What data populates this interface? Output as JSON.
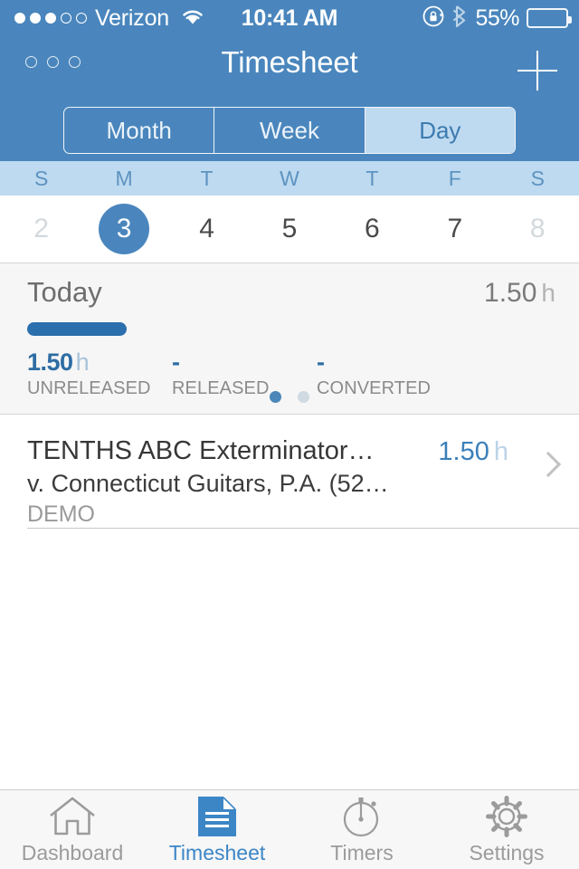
{
  "status_bar": {
    "signal_dots_filled": 3,
    "signal_dots_total": 5,
    "carrier": "Verizon",
    "wifi_icon": "wifi-icon",
    "time": "10:41 AM",
    "rotation_lock_icon": "rotation-lock-icon",
    "bluetooth_icon": "bluetooth-icon",
    "battery_percent": "55%",
    "battery_level": 55
  },
  "nav_bar": {
    "title": "Timesheet",
    "menu_icon": "three-dots-menu-icon",
    "add_icon": "plus-icon"
  },
  "segmented_control": {
    "options": [
      {
        "label": "Month",
        "selected": false
      },
      {
        "label": "Week",
        "selected": false
      },
      {
        "label": "Day",
        "selected": true
      }
    ]
  },
  "week_strip": {
    "day_names": [
      "S",
      "M",
      "T",
      "W",
      "T",
      "F",
      "S"
    ],
    "dates": [
      {
        "day": "2",
        "selected": false,
        "dimmed": true
      },
      {
        "day": "3",
        "selected": true,
        "dimmed": false
      },
      {
        "day": "4",
        "selected": false,
        "dimmed": false
      },
      {
        "day": "5",
        "selected": false,
        "dimmed": false
      },
      {
        "day": "6",
        "selected": false,
        "dimmed": false
      },
      {
        "day": "7",
        "selected": false,
        "dimmed": false
      },
      {
        "day": "8",
        "selected": false,
        "dimmed": true
      }
    ]
  },
  "summary": {
    "title": "Today",
    "total_value": "1.50",
    "total_unit": "h",
    "progress_percent": 24,
    "stats": [
      {
        "value": "1.50",
        "unit": "h",
        "label": "UNRELEASED"
      },
      {
        "value": "-",
        "unit": "",
        "label": "RELEASED"
      },
      {
        "value": "-",
        "unit": "",
        "label": "CONVERTED"
      }
    ],
    "page_dots": {
      "count": 2,
      "active_index": 0
    }
  },
  "entries": [
    {
      "title": "TENTHS ABC Exterminator…",
      "subtitle": "v. Connecticut Guitars, P.A. (52…",
      "tag": "DEMO",
      "hours": "1.50",
      "unit": "h",
      "chevron_icon": "chevron-right-icon"
    }
  ],
  "tab_bar": {
    "tabs": [
      {
        "label": "Dashboard",
        "icon": "home-icon",
        "active": false
      },
      {
        "label": "Timesheet",
        "icon": "document-icon",
        "active": true
      },
      {
        "label": "Timers",
        "icon": "stopwatch-icon",
        "active": false
      },
      {
        "label": "Settings",
        "icon": "gear-icon",
        "active": false
      }
    ]
  },
  "colors": {
    "header_blue": "#4a86bd",
    "light_blue": "#bedaf0",
    "accent_blue": "#2e6da4",
    "progress_blue": "#2c6fad",
    "card_bg": "#f6f6f6",
    "tabbar_bg": "#f7f7f7"
  }
}
